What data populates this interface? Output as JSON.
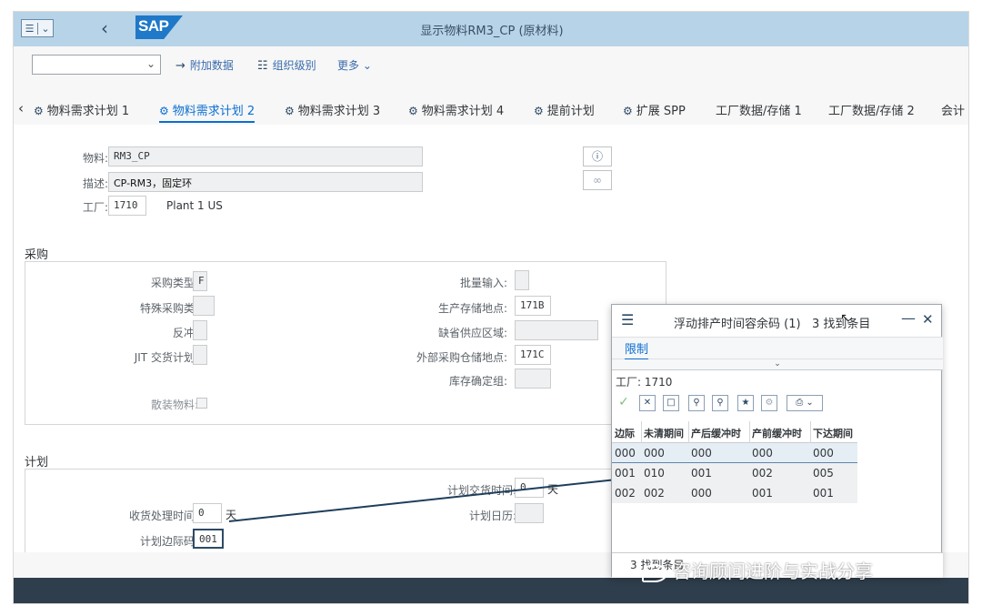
{
  "window": {
    "title": "显示物料RM3_CP (原材料)",
    "brand": "SAP"
  },
  "toolbar": {
    "dropdown_value": "",
    "items": [
      {
        "icon": "arrow-right-icon",
        "label": "附加数据"
      },
      {
        "icon": "org-level-icon",
        "label": "组织级别"
      },
      {
        "icon": "",
        "label": "更多"
      }
    ]
  },
  "tabs": [
    {
      "label": "物料需求计划 1",
      "active": false
    },
    {
      "label": "物料需求计划 2",
      "active": true
    },
    {
      "label": "物料需求计划 3",
      "active": false
    },
    {
      "label": "物料需求计划 4",
      "active": false
    },
    {
      "label": "提前计划",
      "active": false
    },
    {
      "label": "扩展 SPP",
      "active": false
    },
    {
      "label": "工厂数据/存储 1",
      "active": false
    },
    {
      "label": "工厂数据/存储 2",
      "active": false
    },
    {
      "label": "会计",
      "active": false
    }
  ],
  "header": {
    "material_label": "物料:",
    "material_value": "RM3_CP",
    "desc_label": "描述:",
    "desc_value": "CP-RM3，固定环",
    "plant_label": "工厂:",
    "plant_value": "1710",
    "plant_name": "Plant 1 US"
  },
  "procurement": {
    "title": "采购",
    "proc_type_label": "采购类型:",
    "proc_type_value": "F",
    "special_proc_label": "特殊采购类:",
    "special_proc_value": "",
    "backflush_label": "反冲:",
    "backflush_value": "",
    "jit_label": "JIT 交货计划:",
    "jit_value": "",
    "bulk_label": "散装物料:",
    "batch_entry_label": "批量输入:",
    "batch_entry_value": "",
    "prod_sloc_label": "生产存储地点:",
    "prod_sloc_value": "171B",
    "default_supply_label": "缺省供应区域:",
    "default_supply_value": "",
    "ext_sloc_label": "外部采购仓储地点:",
    "ext_sloc_value": "171C",
    "stock_det_label": "库存确定组:",
    "stock_det_value": ""
  },
  "planning": {
    "title": "计划",
    "planned_delivery_label": "计划交货时间:",
    "planned_delivery_value": "0",
    "planned_delivery_unit": "天",
    "gr_time_label": "收货处理时间:",
    "gr_time_value": "0",
    "gr_time_unit": "天",
    "calendar_label": "计划日历:",
    "calendar_value": "",
    "sm_key_label": "计划边际码:",
    "sm_key_value": "001"
  },
  "popup": {
    "title": "浮动排产时间容余码 (1)",
    "count_text": "3 找到条目",
    "tab_label": "限制",
    "filter_text": "工厂: 1710",
    "columns": [
      "边际",
      "未清期间",
      "产后缓冲时",
      "产前缓冲时",
      "下达期间"
    ],
    "rows": [
      [
        "000",
        "000",
        "000",
        "000",
        "000"
      ],
      [
        "001",
        "010",
        "001",
        "002",
        "005"
      ],
      [
        "002",
        "002",
        "000",
        "001",
        "001"
      ]
    ],
    "footer_text": "3 找到条目"
  },
  "watermark": "咨询顾问进阶与实战分享"
}
